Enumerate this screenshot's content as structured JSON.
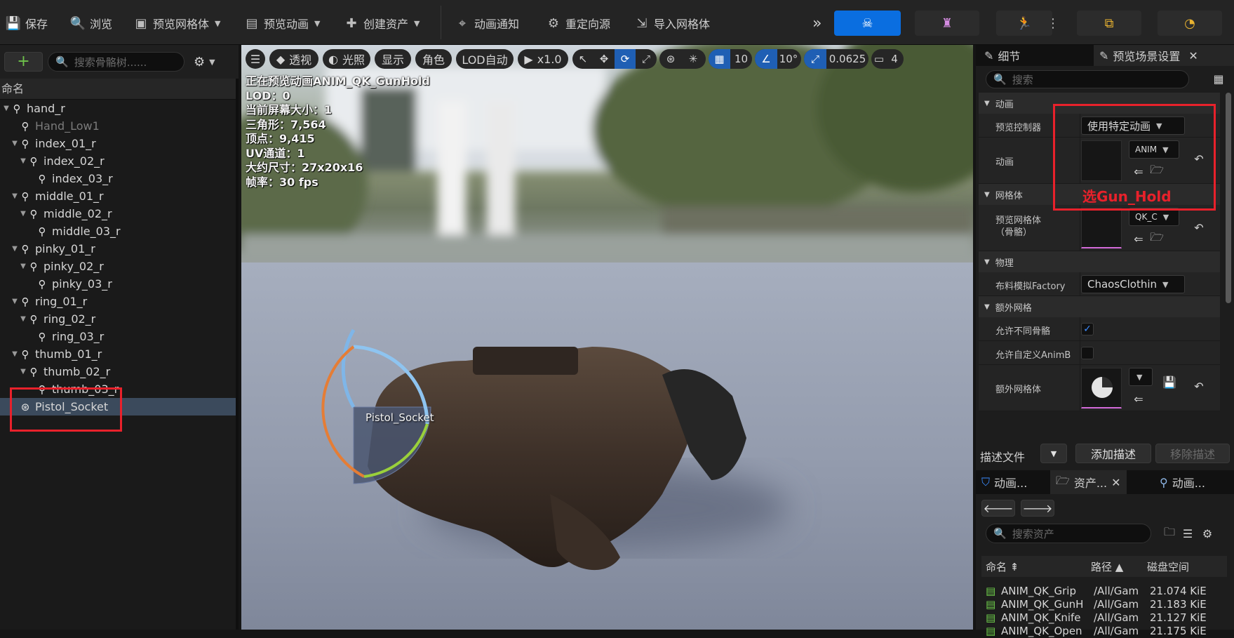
{
  "toolbar": {
    "save": "保存",
    "browse": "浏览",
    "preview_mesh": "预览网格体",
    "preview_anim": "预览动画",
    "create_asset": "创建资产",
    "anim_notify": "动画通知",
    "retarget": "重定向源",
    "import_mesh": "导入网格体"
  },
  "skeleton_tree": {
    "search_placeholder": "搜索骨骼树......",
    "column_header": "命名",
    "bones": [
      {
        "name": "hand_r"
      },
      {
        "name": "Hand_Low1"
      },
      {
        "name": "index_01_r"
      },
      {
        "name": "index_02_r"
      },
      {
        "name": "index_03_r"
      },
      {
        "name": "middle_01_r"
      },
      {
        "name": "middle_02_r"
      },
      {
        "name": "middle_03_r"
      },
      {
        "name": "pinky_01_r"
      },
      {
        "name": "pinky_02_r"
      },
      {
        "name": "pinky_03_r"
      },
      {
        "name": "ring_01_r"
      },
      {
        "name": "ring_02_r"
      },
      {
        "name": "ring_03_r"
      },
      {
        "name": "thumb_01_r"
      },
      {
        "name": "thumb_02_r"
      },
      {
        "name": "thumb_03_r"
      },
      {
        "name": "Pistol_Socket"
      }
    ]
  },
  "viewport": {
    "perspective": "透视",
    "lit": "光照",
    "show": "显示",
    "character": "角色",
    "lod": "LOD自动",
    "play_rate": "x1.0",
    "grid_snap": "10",
    "rot_snap": "10°",
    "scale_snap": "0.0625",
    "cam_speed": "4",
    "stats": [
      "正在预览动画ANIM_QK_GunHold",
      "LOD：0",
      "当前屏幕大小：1",
      "三角形：7,564",
      "顶点：9,415",
      "UV通道：1",
      "大约尺寸：27x20x16",
      "帧率：30 fps"
    ],
    "socket_label": "Pistol_Socket"
  },
  "details": {
    "tab_details": "细节",
    "tab_scene": "预览场景设置",
    "search_placeholder": "搜索",
    "sec_anim": "动画",
    "preview_controller_label": "预览控制器",
    "preview_controller_value": "使用特定动画",
    "anim_label": "动画",
    "anim_value": "ANIM",
    "sec_mesh": "网格体",
    "preview_mesh_label": "预览网格体\n（骨骼）",
    "preview_mesh_value": "QK_C",
    "sec_physics": "物理",
    "cloth_label": "布料模拟Factory",
    "cloth_value": "ChaosClothin",
    "sec_extra": "额外网格",
    "allow_diff_label": "允许不同骨骼",
    "allow_custom_label": "允许自定义AnimB",
    "extra_mesh_label": "额外网格体",
    "profile_label": "描述文件",
    "add_profile": "添加描述",
    "remove_profile": "移除描述",
    "annotation": "选Gun_Hold"
  },
  "asset_browser": {
    "tab1": "动画...",
    "tab2": "资产...",
    "tab3": "动画...",
    "search_placeholder": "搜索资产",
    "col_name": "命名",
    "col_path": "路径",
    "col_disk": "磁盘空间",
    "rows": [
      {
        "name": "ANIM_QK_Grip",
        "path": "/All/Gam",
        "size": "21.074 KiE"
      },
      {
        "name": "ANIM_QK_GunH",
        "path": "/All/Gam",
        "size": "21.183 KiE"
      },
      {
        "name": "ANIM_QK_Knife",
        "path": "/All/Gam",
        "size": "21.127 KiE"
      },
      {
        "name": "ANIM_QK_Open",
        "path": "/All/Gam",
        "size": "21.175 KiE"
      }
    ]
  },
  "colors": {
    "accent": "#0a6ee0",
    "annotation_red": "#e8212b"
  }
}
